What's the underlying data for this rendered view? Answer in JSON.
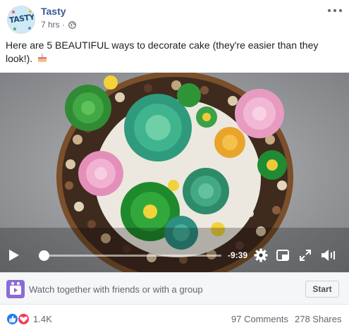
{
  "post": {
    "page_name": "Tasty",
    "avatar_text": "TASTY",
    "time": "7 hrs",
    "separator": "·",
    "privacy_icon": "globe-icon",
    "text": "Here are 5 BEAUTIFUL ways to decorate cake (they're easier than they look!).",
    "emoji_icon": "cake-icon"
  },
  "video": {
    "time_remaining": "-9:39",
    "progress": 0.0,
    "icons": [
      "play-icon",
      "gear-icon",
      "pip-icon",
      "fullscreen-icon",
      "volume-icon"
    ]
  },
  "watch_party": {
    "label": "Watch together with friends or with a group",
    "button_label": "Start",
    "icon": "watch-party-icon"
  },
  "engagement": {
    "reaction_count": "1.4K",
    "comments": "97 Comments",
    "shares": "278 Shares",
    "reaction_icons": [
      "like-icon",
      "love-icon"
    ]
  },
  "colors": {
    "link_blue": "#385898",
    "like_blue": "#2078f4",
    "love_red": "#f33e58",
    "watch_purple": "#8a6bd8"
  }
}
